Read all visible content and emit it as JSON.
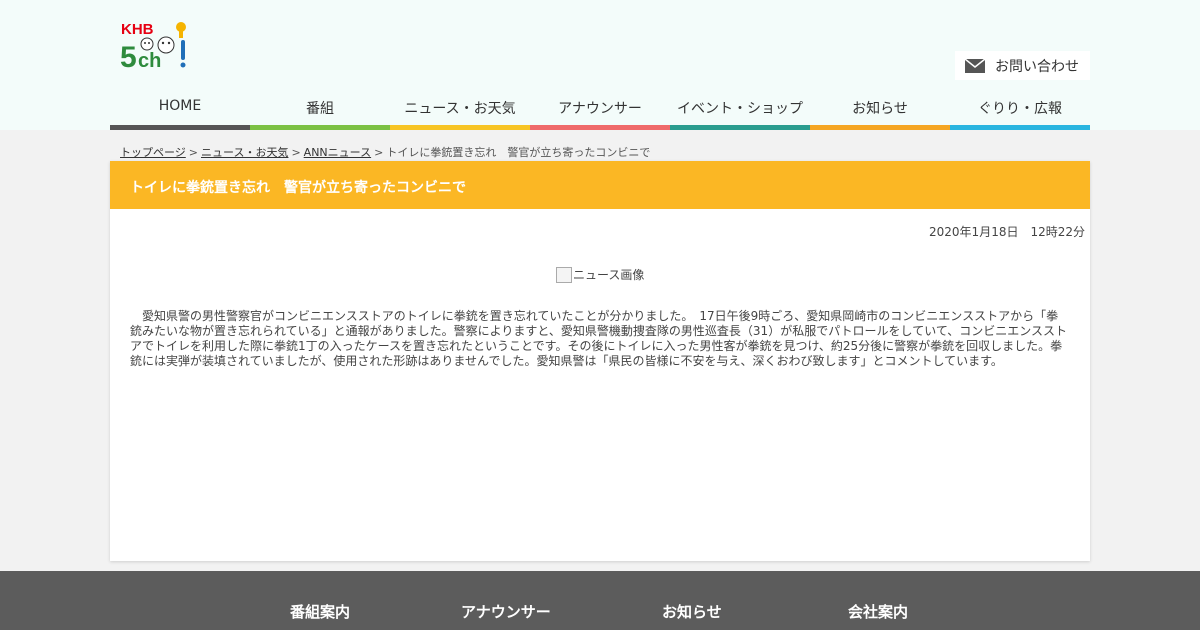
{
  "header": {
    "logo_text": "KHB 5ch!",
    "contact_label": "お問い合わせ"
  },
  "nav": {
    "items": [
      {
        "label": "HOME",
        "color": "#555555"
      },
      {
        "label": "番組",
        "color": "#7bc143"
      },
      {
        "label": "ニュース・お天気",
        "color": "#f7c525"
      },
      {
        "label": "アナウンサー",
        "color": "#ef6b6b"
      },
      {
        "label": "イベント・ショップ",
        "color": "#2a9d8f"
      },
      {
        "label": "お知らせ",
        "color": "#f5a623"
      },
      {
        "label": "ぐりり・広報",
        "color": "#29b5e0"
      }
    ]
  },
  "breadcrumb": {
    "items": [
      "トップページ",
      "ニュース・お天気",
      "ANNニュース"
    ],
    "current": "トイレに拳銃置き忘れ　警官が立ち寄ったコンビニで"
  },
  "article": {
    "title": "トイレに拳銃置き忘れ　警官が立ち寄ったコンビニで",
    "date": "2020年1月18日　12時22分",
    "image_alt": "ニュース画像",
    "body": "　愛知県警の男性警察官がコンビニエンスストアのトイレに拳銃を置き忘れていたことが分かりました。　17日午後9時ごろ、愛知県岡崎市のコンビニエンスストアから「拳銃みたいな物が置き忘れられている」と通報がありました。警察によりますと、愛知県警機動捜査隊の男性巡査長（31）が私服でパトロールをしていて、コンビニエンスストアでトイレを利用した際に拳銃1丁の入ったケースを置き忘れたということです。その後にトイレに入った男性客が拳銃を見つけ、約25分後に警察が拳銃を回収しました。拳銃には実弾が装填されていましたが、使用された形跡はありませんでした。愛知県警は「県民の皆様に不安を与え、深くおわび致します」とコメントしています。",
    "title_bar_color": "#fbb724"
  },
  "footer": {
    "links": [
      "番組案内",
      "アナウンサー",
      "お知らせ",
      "会社案内"
    ]
  }
}
